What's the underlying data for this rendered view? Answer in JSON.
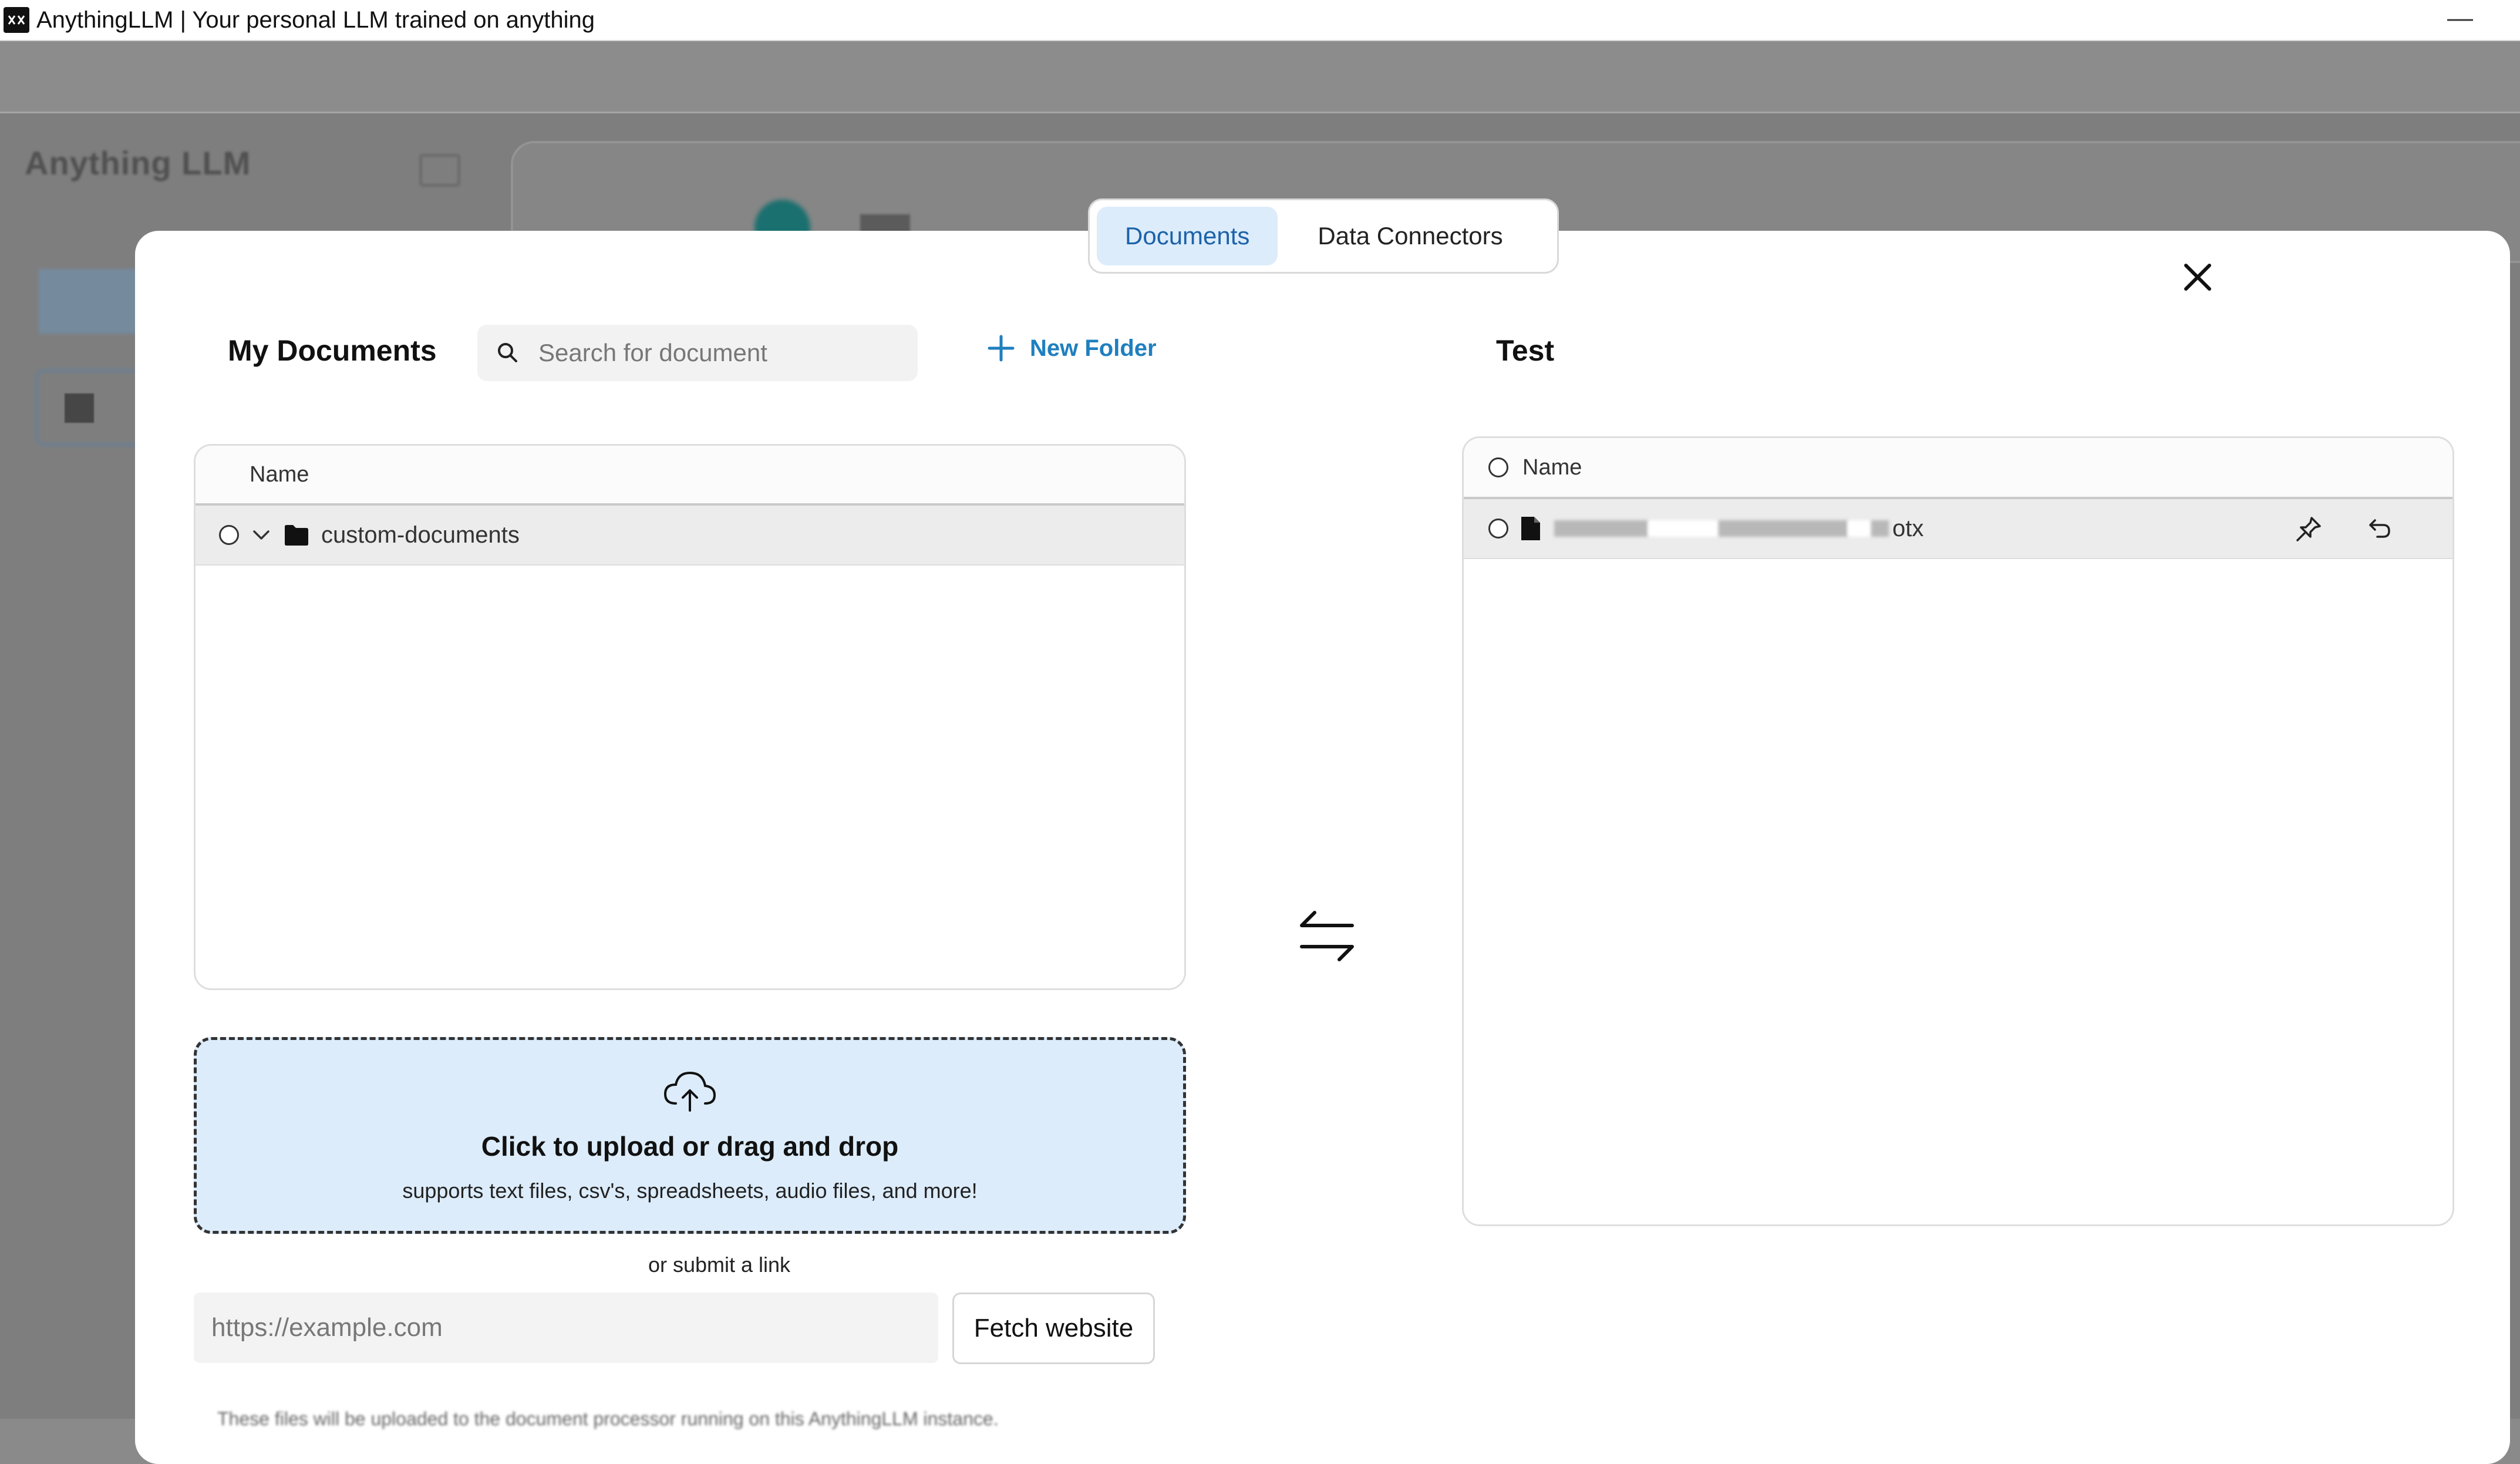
{
  "window": {
    "title": "AnythingLLM | Your personal LLM trained on anything",
    "minimize_label": "—"
  },
  "background": {
    "logo_text": "Anything LLM"
  },
  "modal": {
    "tabs": [
      {
        "label": "Documents",
        "active": true
      },
      {
        "label": "Data Connectors",
        "active": false
      }
    ],
    "my_documents": {
      "title": "My Documents",
      "search_placeholder": "Search for document",
      "new_folder_label": "New Folder",
      "column_name": "Name",
      "folders": [
        {
          "name": "custom-documents",
          "expanded": true
        }
      ]
    },
    "workspace": {
      "title": "Test",
      "column_name": "Name",
      "files": [
        {
          "name_visible_suffix": "otx",
          "name_redacted": true
        }
      ]
    },
    "upload": {
      "title": "Click to upload or drag and drop",
      "subtitle": "supports text files, csv's, spreadsheets, audio files, and more!",
      "or_link": "or submit a link",
      "url_placeholder": "https://example.com",
      "fetch_label": "Fetch website"
    },
    "footnote": "These files will be uploaded to the document processor running on this AnythingLLM instance."
  },
  "colors": {
    "accent_blue": "#1f7fbf",
    "active_tab_bg": "#dcecfb",
    "upload_bg": "#dcecfb",
    "overlay": "#7e7e7e"
  }
}
